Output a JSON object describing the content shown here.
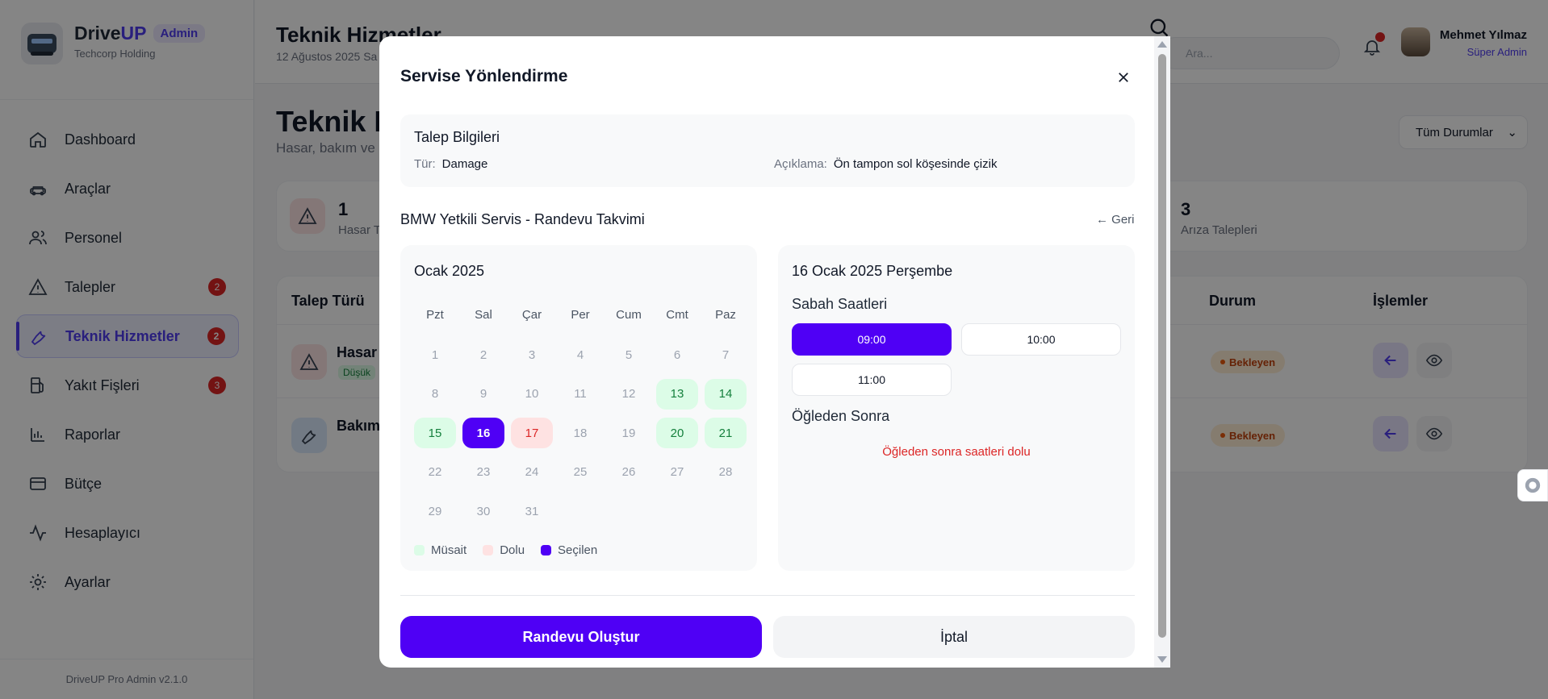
{
  "app": {
    "brand_prefix": "Drive",
    "brand_suffix": "UP",
    "admin_badge": "Admin",
    "company": "Techcorp Holding",
    "version": "DriveUP Pro Admin v2.1.0"
  },
  "sidebar": {
    "items": [
      {
        "label": "Dashboard",
        "icon": "home-icon"
      },
      {
        "label": "Araçlar",
        "icon": "car-icon"
      },
      {
        "label": "Personel",
        "icon": "users-icon"
      },
      {
        "label": "Talepler",
        "icon": "warning-icon",
        "badge": "2"
      },
      {
        "label": "Teknik Hizmetler",
        "icon": "wrench-icon",
        "badge": "2",
        "active": true
      },
      {
        "label": "Yakıt Fişleri",
        "icon": "fuel-icon",
        "badge": "3"
      },
      {
        "label": "Raporlar",
        "icon": "chart-icon"
      },
      {
        "label": "Bütçe",
        "icon": "card-icon"
      },
      {
        "label": "Hesaplayıcı",
        "icon": "activity-icon"
      },
      {
        "label": "Ayarlar",
        "icon": "gear-icon"
      }
    ]
  },
  "header": {
    "title": "Teknik Hizmetler",
    "date": "12 Ağustos 2025 Sa",
    "search_placeholder": "Ara...",
    "user_name": "Mehmet Yılmaz",
    "user_role": "Süper Admin"
  },
  "main": {
    "title": "Teknik H",
    "subtitle": "Hasar, bakım ve a",
    "filter_label": "Tüm Durumlar",
    "stats": [
      {
        "value": "1",
        "label": "Hasar Ta"
      },
      {
        "value": "3",
        "label": "Arıza Talepleri"
      }
    ],
    "table": {
      "col_type": "Talep Türü",
      "col_status": "Durum",
      "col_actions": "İşlemler",
      "rows": [
        {
          "title": "Hasar",
          "tag": "Düşük",
          "status": "Bekleyen"
        },
        {
          "title": "Bakım",
          "tag": "",
          "status": "Bekleyen"
        }
      ]
    }
  },
  "modal": {
    "title": "Servise Yönlendirme",
    "info": {
      "heading": "Talep Bilgileri",
      "type_key": "Tür:",
      "type_value": "Damage",
      "desc_key": "Açıklama:",
      "desc_value": "Ön tampon sol köşesinde çizik"
    },
    "service_title": "BMW Yetkili Servis - Randevu Takvimi",
    "back_link": "← Geri",
    "calendar": {
      "month": "Ocak 2025",
      "weekdays": [
        "Pzt",
        "Sal",
        "Çar",
        "Per",
        "Cum",
        "Cmt",
        "Paz"
      ],
      "weeks": [
        [
          {
            "d": "1",
            "s": "off"
          },
          {
            "d": "2",
            "s": "off"
          },
          {
            "d": "3",
            "s": "off"
          },
          {
            "d": "4",
            "s": "off"
          },
          {
            "d": "5",
            "s": "off"
          },
          {
            "d": "6",
            "s": "off"
          },
          {
            "d": "7",
            "s": "off"
          }
        ],
        [
          {
            "d": "8",
            "s": "off"
          },
          {
            "d": "9",
            "s": "off"
          },
          {
            "d": "10",
            "s": "off"
          },
          {
            "d": "11",
            "s": "off"
          },
          {
            "d": "12",
            "s": "off"
          },
          {
            "d": "13",
            "s": "avail"
          },
          {
            "d": "14",
            "s": "avail"
          }
        ],
        [
          {
            "d": "15",
            "s": "avail"
          },
          {
            "d": "16",
            "s": "sel"
          },
          {
            "d": "17",
            "s": "full"
          },
          {
            "d": "18",
            "s": "off"
          },
          {
            "d": "19",
            "s": "off"
          },
          {
            "d": "20",
            "s": "avail"
          },
          {
            "d": "21",
            "s": "avail"
          }
        ],
        [
          {
            "d": "22",
            "s": "off"
          },
          {
            "d": "23",
            "s": "off"
          },
          {
            "d": "24",
            "s": "off"
          },
          {
            "d": "25",
            "s": "off"
          },
          {
            "d": "26",
            "s": "off"
          },
          {
            "d": "27",
            "s": "off"
          },
          {
            "d": "28",
            "s": "off"
          }
        ],
        [
          {
            "d": "29",
            "s": "off"
          },
          {
            "d": "30",
            "s": "off"
          },
          {
            "d": "31",
            "s": "off"
          }
        ]
      ],
      "legend": [
        {
          "label": "Müsait",
          "color": "#dcfce7"
        },
        {
          "label": "Dolu",
          "color": "#fee2e2"
        },
        {
          "label": "Seçilen",
          "color": "#4f00f5"
        }
      ]
    },
    "slots": {
      "date": "16 Ocak 2025 Perşembe",
      "morning_label": "Sabah Saatleri",
      "morning": [
        {
          "time": "09:00",
          "selected": true
        },
        {
          "time": "10:00",
          "selected": false
        },
        {
          "time": "11:00",
          "selected": false
        }
      ],
      "afternoon_label": "Öğleden Sonra",
      "afternoon_full": "Öğleden sonra saatleri dolu"
    },
    "primary_button": "Randevu Oluştur",
    "cancel_button": "İptal"
  },
  "colors": {
    "accent": "#4f00f5",
    "danger": "#dc2626",
    "available": "#dcfce7",
    "full": "#fee2e2"
  }
}
